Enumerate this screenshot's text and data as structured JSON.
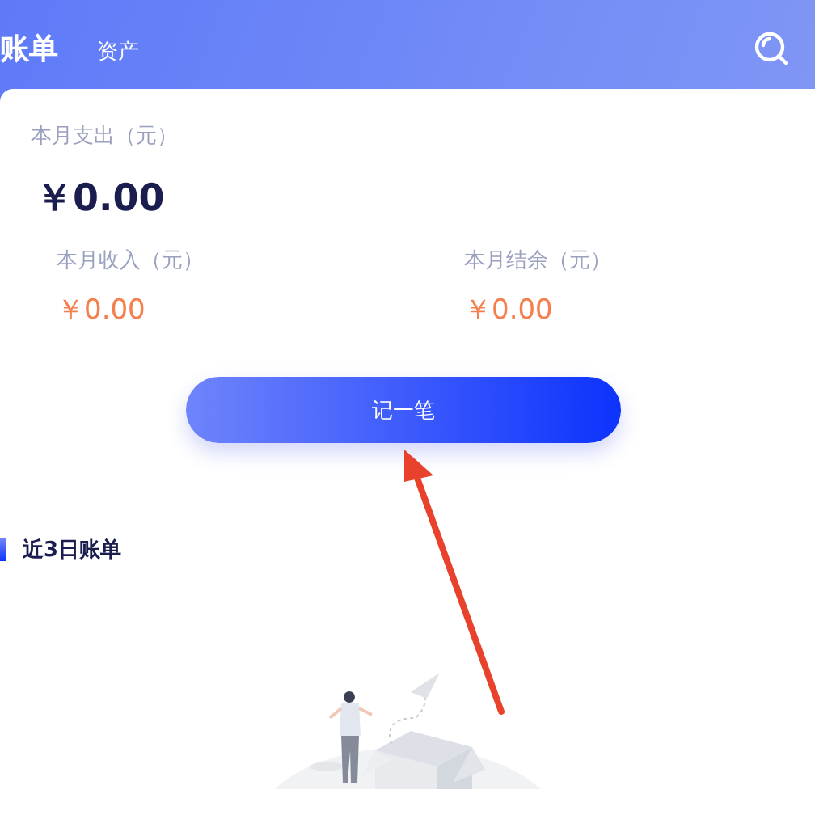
{
  "header": {
    "tabs": [
      {
        "label": "账单",
        "selected": true
      },
      {
        "label": "资产",
        "selected": false
      }
    ]
  },
  "summary": {
    "expense_label": "本月支出（元）",
    "expense": "￥0.00",
    "stats": [
      {
        "label": "本月收入（元）",
        "value": "￥0.00"
      },
      {
        "label": "本月结余（元）",
        "value": "￥0.00"
      }
    ]
  },
  "record_button": "记一笔",
  "recent": {
    "title": "近3日账单"
  }
}
